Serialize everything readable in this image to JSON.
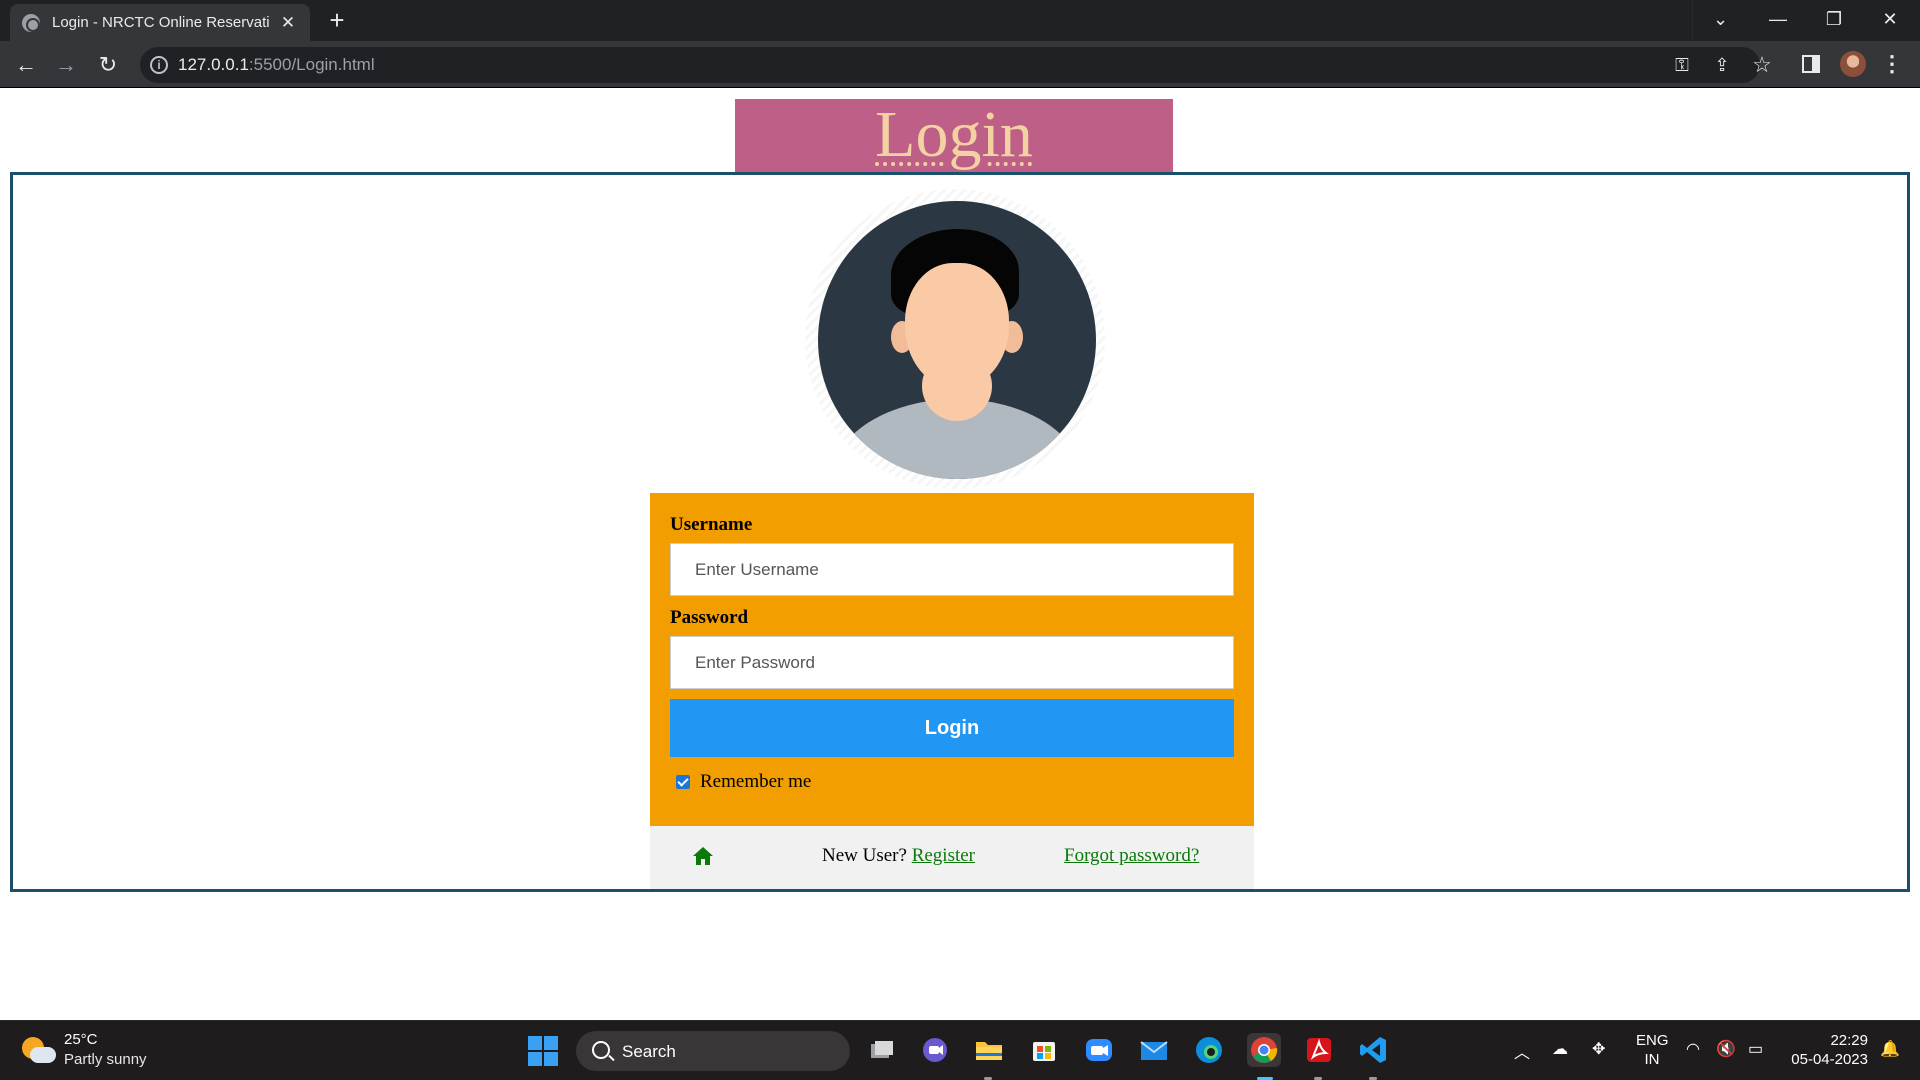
{
  "browser": {
    "tab_title": "Login - NRCTC Online Reservatio",
    "url_host": "127.0.0.1",
    "url_rest": ":5500/Login.html"
  },
  "page": {
    "header_title": "Login",
    "form": {
      "username_label": "Username",
      "username_placeholder": "Enter Username",
      "password_label": "Password",
      "password_placeholder": "Enter Password",
      "login_button": "Login",
      "remember_label": "Remember me",
      "remember_checked": true
    },
    "footer": {
      "new_user_text": "New User?",
      "register_link": "Register",
      "forgot_link": "Forgot password?"
    }
  },
  "taskbar": {
    "weather_temp": "25°C",
    "weather_desc": "Partly sunny",
    "search_label": "Search",
    "language_top": "ENG",
    "language_bottom": "IN",
    "time": "22:29",
    "date": "05-04-2023"
  },
  "colors": {
    "header_bg": "#bd5f86",
    "header_text": "#f2d2a2",
    "form_bg": "#f39e00",
    "button_bg": "#2196f3",
    "link": "#0b7a0b",
    "frame_border": "#19506b"
  }
}
